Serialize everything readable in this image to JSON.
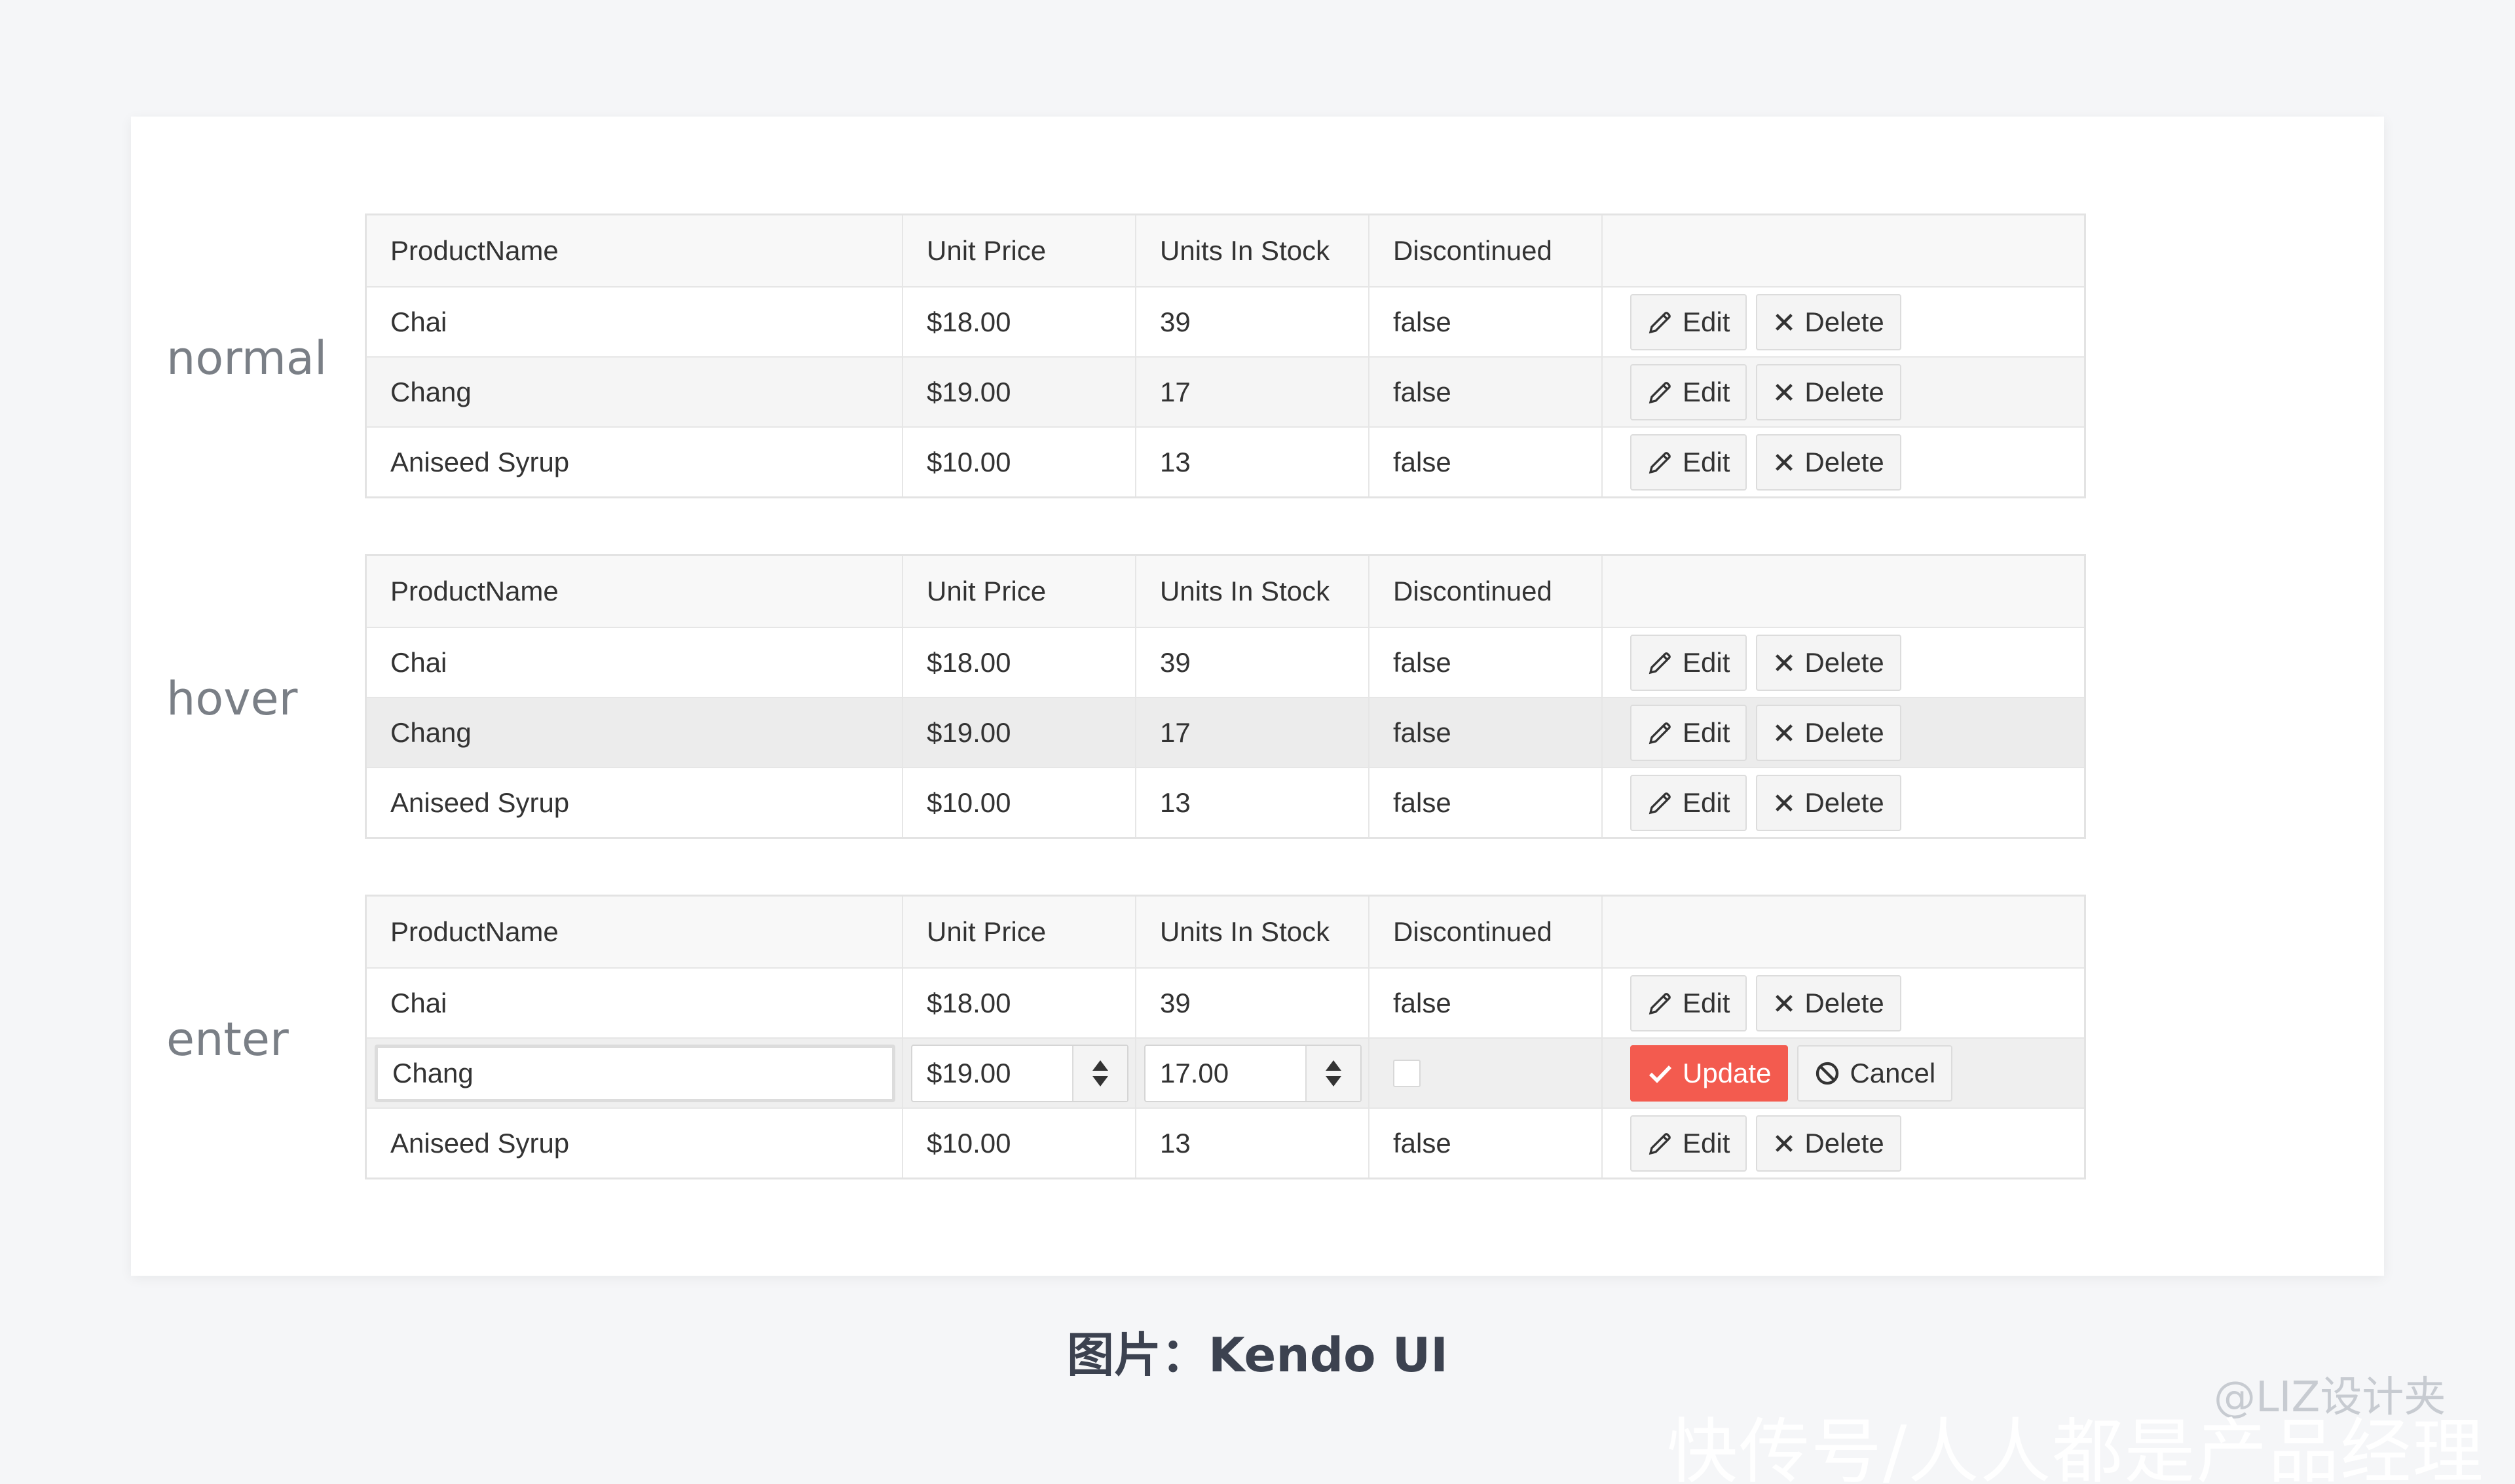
{
  "states": [
    {
      "label": "normal",
      "headers": [
        "ProductName",
        "Unit Price",
        "Units In Stock",
        "Discontinued",
        ""
      ],
      "rows": [
        {
          "name": "Chai",
          "price": "$18.00",
          "stock": "39",
          "discontinued": "false",
          "edit": "Edit",
          "delete": "Delete"
        },
        {
          "name": "Chang",
          "price": "$19.00",
          "stock": "17",
          "discontinued": "false",
          "edit": "Edit",
          "delete": "Delete"
        },
        {
          "name": "Aniseed Syrup",
          "price": "$10.00",
          "stock": "13",
          "discontinued": "false",
          "edit": "Edit",
          "delete": "Delete"
        }
      ]
    },
    {
      "label": "hover",
      "headers": [
        "ProductName",
        "Unit Price",
        "Units In Stock",
        "Discontinued",
        ""
      ],
      "rows": [
        {
          "name": "Chai",
          "price": "$18.00",
          "stock": "39",
          "discontinued": "false",
          "edit": "Edit",
          "delete": "Delete"
        },
        {
          "name": "Chang",
          "price": "$19.00",
          "stock": "17",
          "discontinued": "false",
          "edit": "Edit",
          "delete": "Delete"
        },
        {
          "name": "Aniseed Syrup",
          "price": "$10.00",
          "stock": "13",
          "discontinued": "false",
          "edit": "Edit",
          "delete": "Delete"
        }
      ]
    },
    {
      "label": "enter",
      "headers": [
        "ProductName",
        "Unit Price",
        "Units In Stock",
        "Discontinued",
        ""
      ],
      "rows": [
        {
          "name": "Chai",
          "price": "$18.00",
          "stock": "39",
          "discontinued": "false",
          "edit": "Edit",
          "delete": "Delete"
        },
        {
          "name": "Chang",
          "price": "$19.00",
          "stock": "17.00",
          "discontinued": "",
          "update": "Update",
          "cancel": "Cancel"
        },
        {
          "name": "Aniseed Syrup",
          "price": "$10.00",
          "stock": "13",
          "discontinued": "false",
          "edit": "Edit",
          "delete": "Delete"
        }
      ]
    }
  ],
  "caption": "图片：Kendo UI",
  "watermark_small": "@LIZ设计夹",
  "watermark_big": "快传号/人人都是产品经理",
  "colors": {
    "accent_update": "#f35b4f",
    "background": "#f5f6f8",
    "hover_row": "#ececec"
  },
  "icons": {
    "edit": "pencil-icon",
    "delete": "x-icon",
    "update": "check-icon",
    "cancel": "cancel-circle-icon",
    "spin_up": "spin-up-icon",
    "spin_down": "spin-down-icon"
  }
}
